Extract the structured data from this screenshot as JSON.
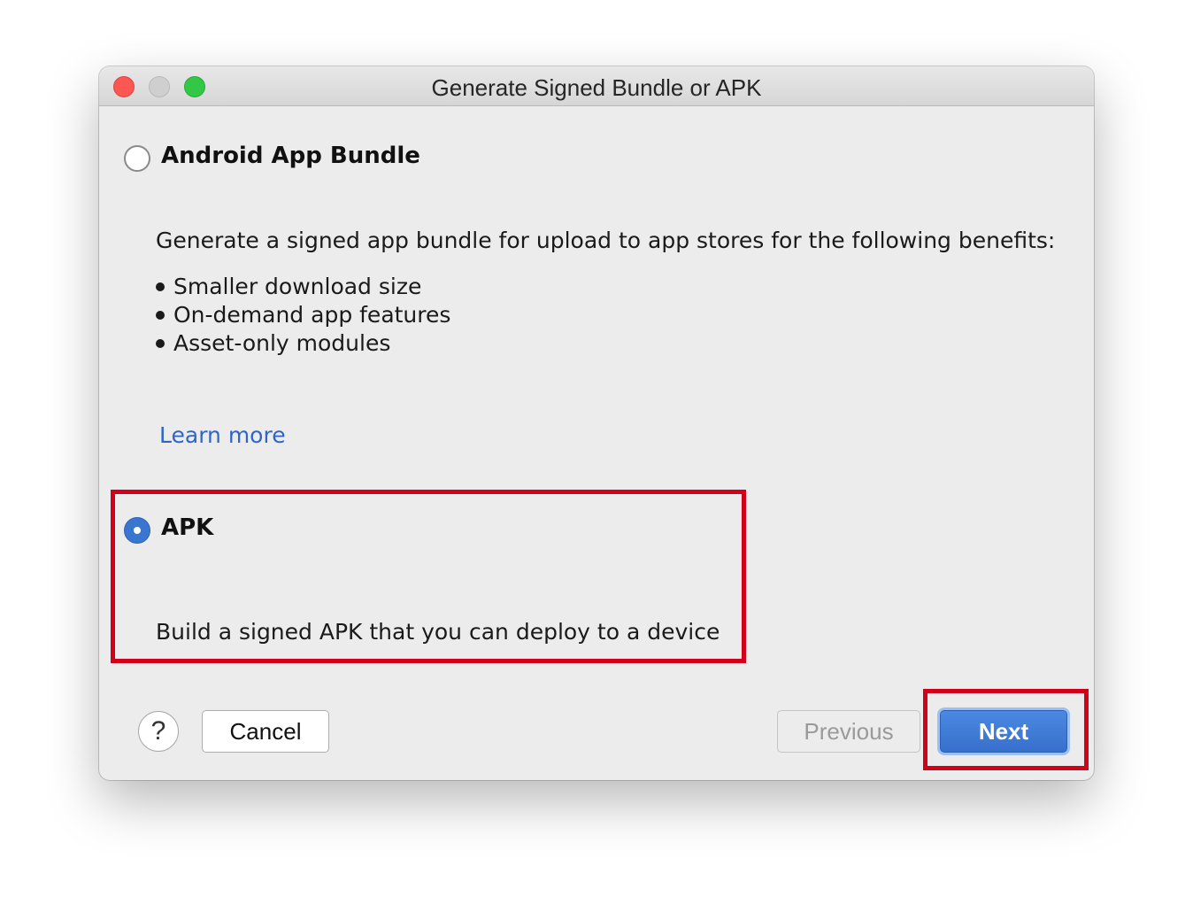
{
  "window": {
    "title": "Generate Signed Bundle or APK"
  },
  "options": {
    "bundle": {
      "label": "Android App Bundle",
      "selected": false,
      "description": "Generate a signed app bundle for upload to app stores for the following benefits:",
      "benefits": [
        "Smaller download size",
        "On-demand app features",
        "Asset-only modules"
      ],
      "learn_more": "Learn more"
    },
    "apk": {
      "label": "APK",
      "selected": true,
      "description": "Build a signed APK that you can deploy to a device"
    }
  },
  "footer": {
    "help_label": "?",
    "cancel_label": "Cancel",
    "previous_label": "Previous",
    "next_label": "Next"
  },
  "colors": {
    "accent": "#3a76d0",
    "link": "#2f65ca",
    "annotation": "#d0021b"
  }
}
